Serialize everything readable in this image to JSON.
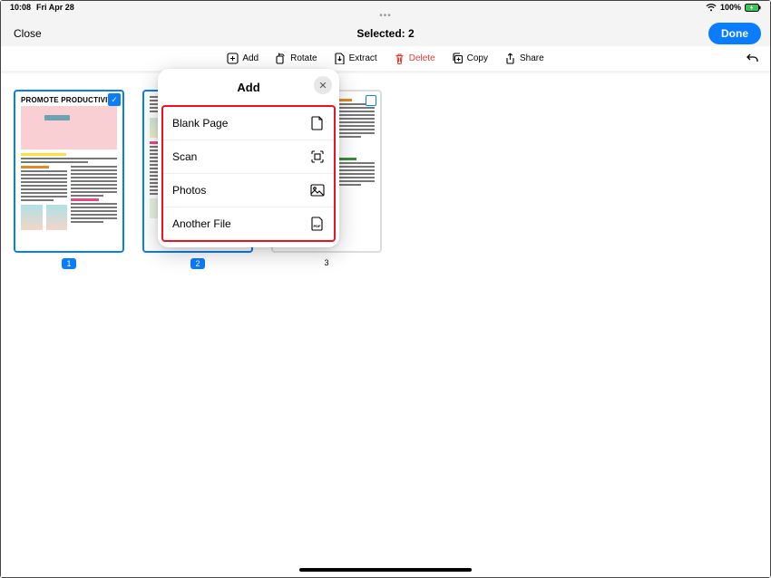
{
  "status": {
    "time": "10:08",
    "date": "Fri Apr 28",
    "battery_pct": "100%"
  },
  "titlebar": {
    "close": "Close",
    "title": "Selected: 2",
    "done": "Done"
  },
  "toolbar": {
    "add": "Add",
    "rotate": "Rotate",
    "extract": "Extract",
    "delete": "Delete",
    "copy": "Copy",
    "share": "Share"
  },
  "thumbs": [
    {
      "num": "1",
      "selected": true,
      "title": "PROMOTE PRODUCTIVITY"
    },
    {
      "num": "2",
      "selected": true,
      "title": ""
    },
    {
      "num": "3",
      "selected": false,
      "title": ""
    }
  ],
  "popover": {
    "title": "Add",
    "items": [
      {
        "label": "Blank Page",
        "icon": "blank-page-icon"
      },
      {
        "label": "Scan",
        "icon": "scan-icon"
      },
      {
        "label": "Photos",
        "icon": "photos-icon"
      },
      {
        "label": "Another File",
        "icon": "pdf-file-icon"
      }
    ]
  }
}
